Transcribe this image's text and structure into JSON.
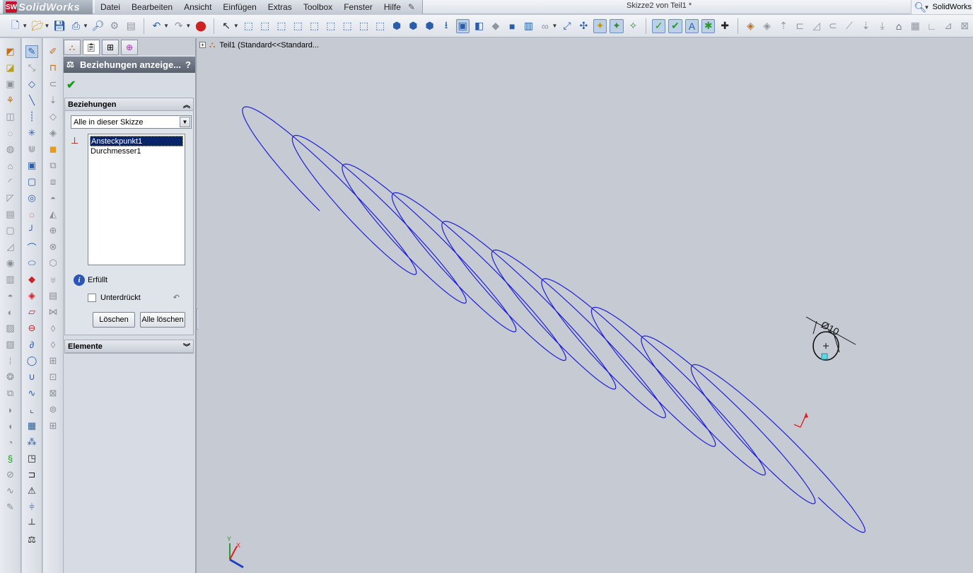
{
  "app": {
    "logo_text": "SolidWorks",
    "document_title": "Skizze2 von Teil1 *",
    "search_label": "SolidWorks"
  },
  "menu": [
    "Datei",
    "Bearbeiten",
    "Ansicht",
    "Einfügen",
    "Extras",
    "Toolbox",
    "Fenster",
    "Hilfe"
  ],
  "property_manager": {
    "title": "Beziehungen anzeige...",
    "help": "?",
    "relations_group": {
      "title": "Beziehungen",
      "filter_value": "Alle in dieser Skizze",
      "items": [
        "Ansteckpunkt1",
        "Durchmesser1"
      ],
      "selected_index": 0,
      "status": "Erfüllt",
      "suppressed_label": "Unterdrückt",
      "suppressed": false,
      "delete_label": "Löschen",
      "delete_all_label": "Alle löschen"
    },
    "elements_group": {
      "title": "Elemente"
    }
  },
  "feature_tree": {
    "root_label": "Teil1  (Standard<<Standard..."
  },
  "graphics": {
    "dimension_text": "Ø10",
    "curve_color": "#1f1fd6",
    "origin_color": "#e02020"
  },
  "axes": {
    "x": "X",
    "y": "Y"
  }
}
